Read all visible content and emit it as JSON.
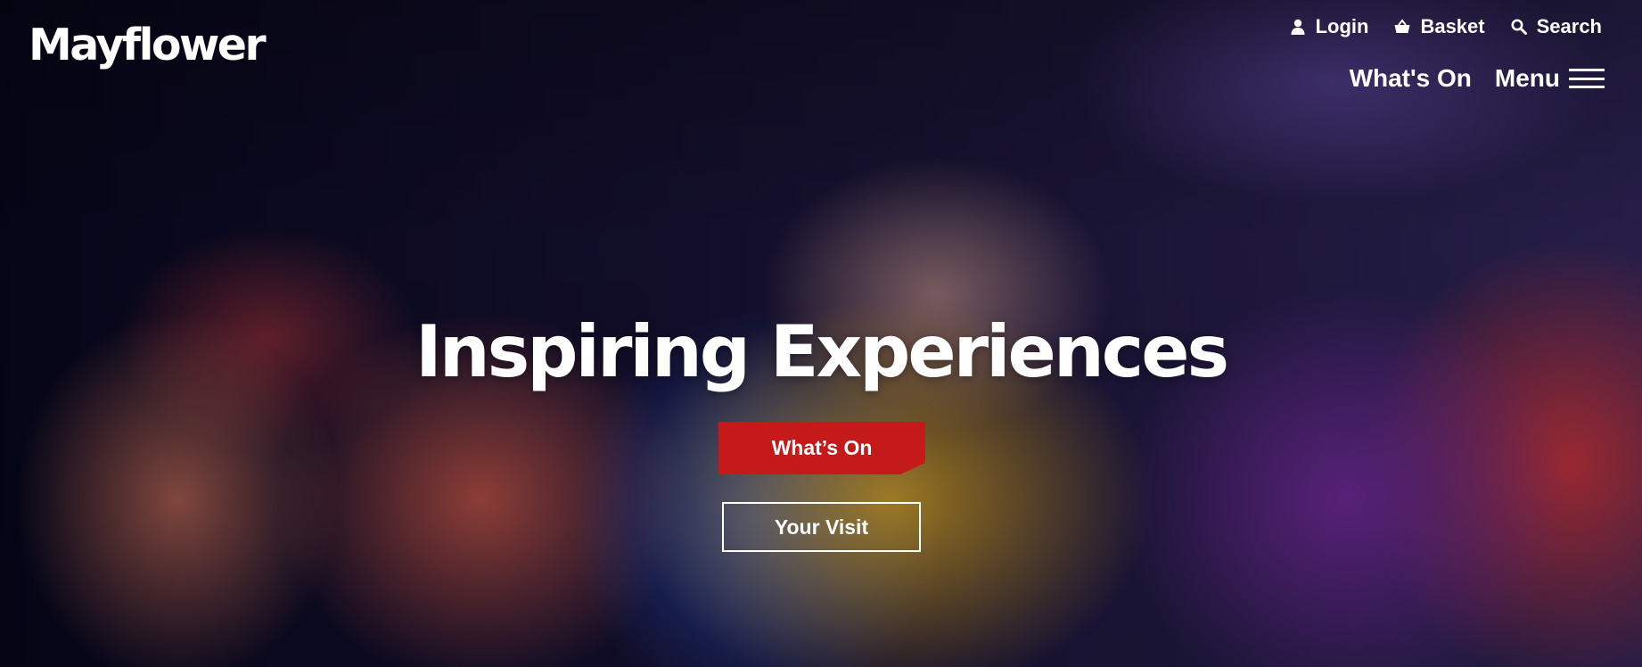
{
  "header": {
    "logo": "Mayflower",
    "utility": {
      "login": "Login",
      "basket": "Basket",
      "search": "Search"
    },
    "nav": {
      "whats_on": "What's On",
      "menu": "Menu"
    }
  },
  "hero": {
    "headline": "Inspiring Experiences",
    "primary_cta": "What’s On",
    "secondary_cta": "Your Visit"
  },
  "icons": {
    "login": "user-icon",
    "basket": "basket-icon",
    "search": "search-icon",
    "menu": "hamburger-icon"
  },
  "colors": {
    "accent": "#c41a1a",
    "text": "#ffffff"
  }
}
